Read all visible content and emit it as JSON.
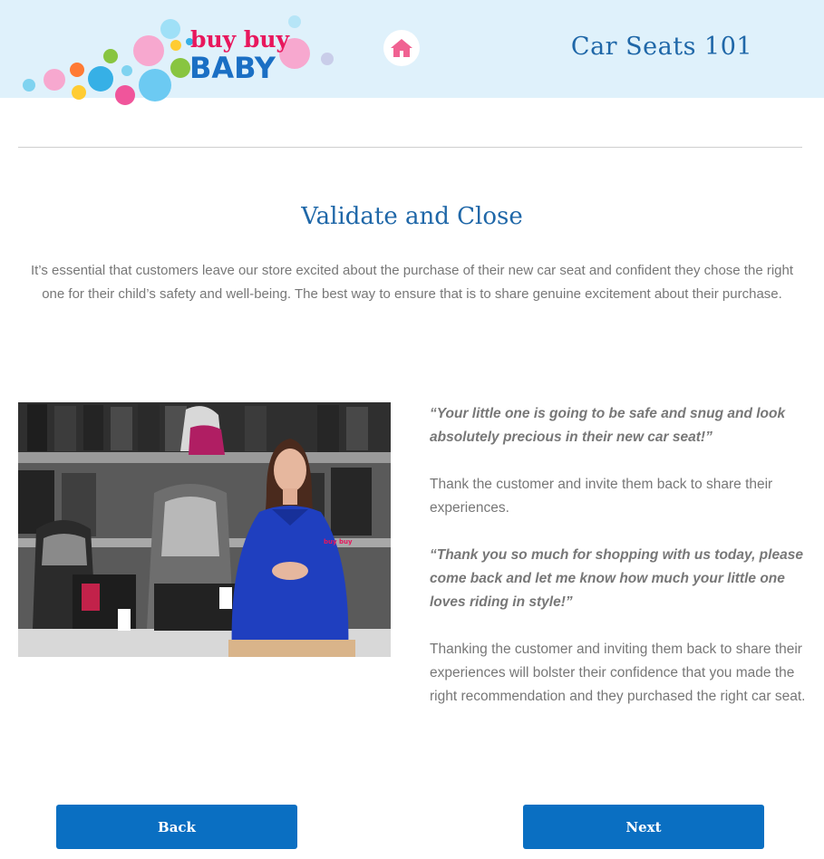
{
  "header": {
    "logo_line1": "buy buy",
    "logo_line2": "BABY",
    "course_title": "Car Seats 101"
  },
  "main": {
    "section_title": "Validate and Close",
    "intro": "It’s essential that customers leave our store excited about the purchase of their new car seat and confident they chose the right one for their child’s safety and well-being. The best way to ensure that is to share genuine excitement about their purchase.",
    "quote1": "“Your little one is going to be safe and snug and look absolutely precious in their new car seat!”",
    "paragraph1": "Thank the customer and invite them back to share their experiences.",
    "quote2": "“Thank you so much for shopping with us today, please come back and let me know how much your little one loves riding in style!”",
    "paragraph2": "Thanking the customer and inviting them back to share their experiences will bolster their confidence that you made the right recommendation and they purchased the right car seat.",
    "video_shirt_logo": "buy buy"
  },
  "nav": {
    "back_label": "Back",
    "next_label": "Next"
  },
  "colors": {
    "header_bg": "#dff1fb",
    "title_blue": "#1f67a8",
    "button_blue": "#0a6fc2",
    "home_pink": "#f06292",
    "logo_pink": "#e8175d",
    "logo_blue": "#1a6fc4"
  },
  "icons": {
    "home": "home-icon"
  }
}
